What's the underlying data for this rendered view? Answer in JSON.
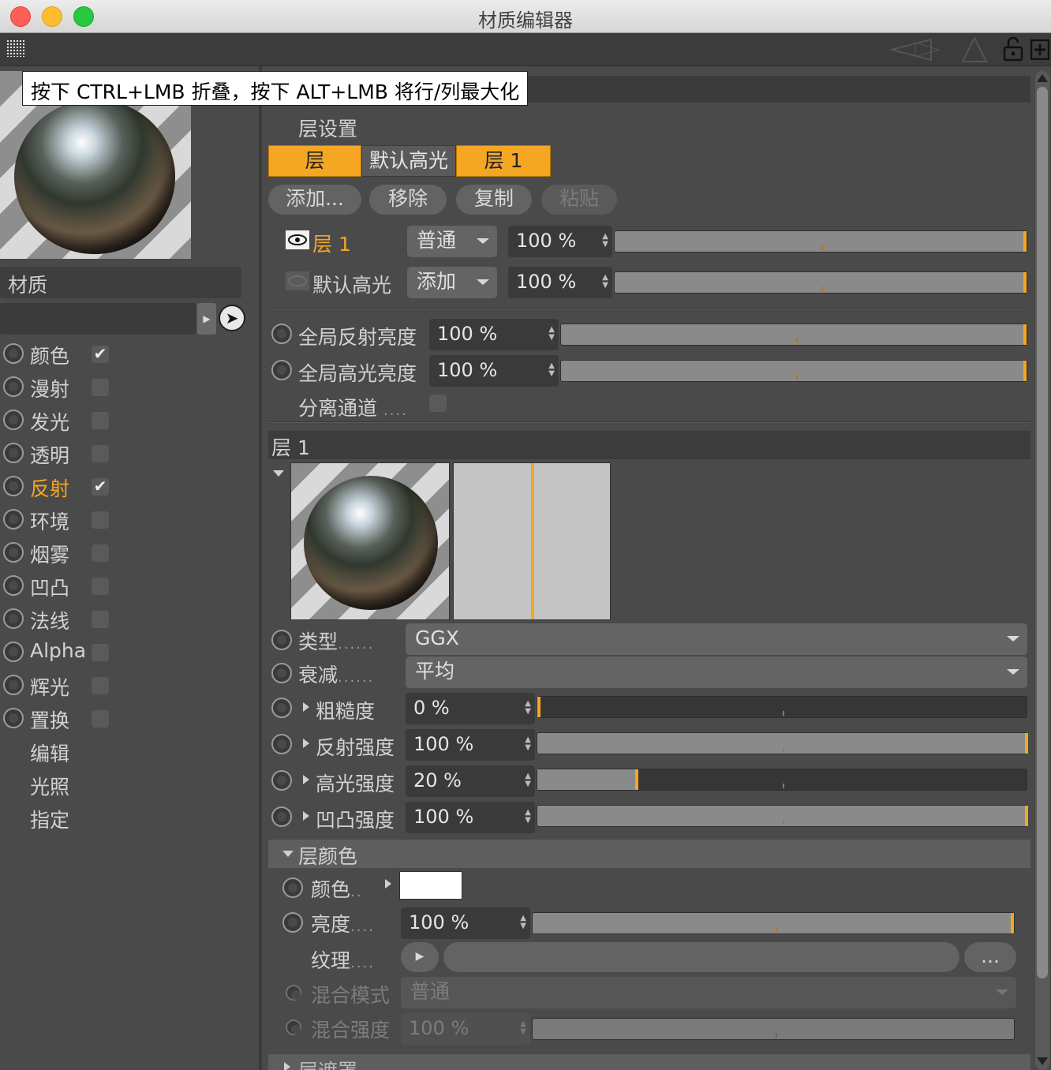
{
  "window": {
    "title": "材质编辑器"
  },
  "tooltip": "按下 CTRL+LMB 折叠，按下 ALT+LMB 将行/列最大化",
  "left": {
    "material_label": "材质",
    "channels": [
      {
        "label": "颜色",
        "checked": true,
        "active": false
      },
      {
        "label": "漫射",
        "checked": false,
        "active": false
      },
      {
        "label": "发光",
        "checked": false,
        "active": false
      },
      {
        "label": "透明",
        "checked": false,
        "active": false
      },
      {
        "label": "反射",
        "checked": true,
        "active": true
      },
      {
        "label": "环境",
        "checked": false,
        "active": false
      },
      {
        "label": "烟雾",
        "checked": false,
        "active": false
      },
      {
        "label": "凹凸",
        "checked": false,
        "active": false
      },
      {
        "label": "法线",
        "checked": false,
        "active": false
      },
      {
        "label": "Alpha",
        "checked": false,
        "active": false
      },
      {
        "label": "辉光",
        "checked": false,
        "active": false
      },
      {
        "label": "置换",
        "checked": false,
        "active": false
      }
    ],
    "extra": [
      "编辑",
      "光照",
      "指定"
    ],
    "check_glyph": "✔"
  },
  "layers": {
    "header": "层设置",
    "tabs": [
      "层",
      "默认高光",
      "层 1"
    ],
    "buttons": {
      "add": "添加...",
      "remove": "移除",
      "copy": "复制",
      "paste": "粘贴"
    },
    "rows": [
      {
        "name": "层 1",
        "mode": "普通",
        "value": "100 %",
        "fraction": 1.0
      },
      {
        "name": "默认高光",
        "mode": "添加",
        "value": "100 %",
        "fraction": 1.0
      }
    ]
  },
  "global": {
    "refl_label": "全局反射亮度",
    "refl_value": "100 %",
    "refl_fraction": 1.0,
    "spec_label": "全局高光亮度",
    "spec_value": "100 %",
    "spec_fraction": 1.0,
    "separate_label": "分离通道",
    "separate_dots": "...."
  },
  "layer1": {
    "header": "层 1",
    "type_label": "类型",
    "type_value": "GGX",
    "atten_label": "衰减",
    "atten_value": "平均",
    "params": [
      {
        "label": "粗糙度",
        "value": "0 %",
        "fraction": 0.0
      },
      {
        "label": "反射强度",
        "value": "100 %",
        "fraction": 1.0
      },
      {
        "label": "高光强度",
        "value": "20 %",
        "fraction": 0.2
      },
      {
        "label": "凹凸强度",
        "value": "100 %",
        "fraction": 1.0
      }
    ]
  },
  "layer_color": {
    "header": "层颜色",
    "color_label": "颜色",
    "color_value": "#ffffff",
    "brightness_label": "亮度",
    "brightness_value": "100 %",
    "brightness_fraction": 1.0,
    "texture_label": "纹理",
    "texture_more": "...",
    "blend_mode_label": "混合模式",
    "blend_mode_value": "普通",
    "blend_strength_label": "混合强度",
    "blend_strength_value": "100 %"
  },
  "layer_mask": {
    "header": "层遮罩"
  },
  "colors": {
    "accent": "#f5a623",
    "panel": "#4a4a4a",
    "field": "#3a3a3a"
  }
}
